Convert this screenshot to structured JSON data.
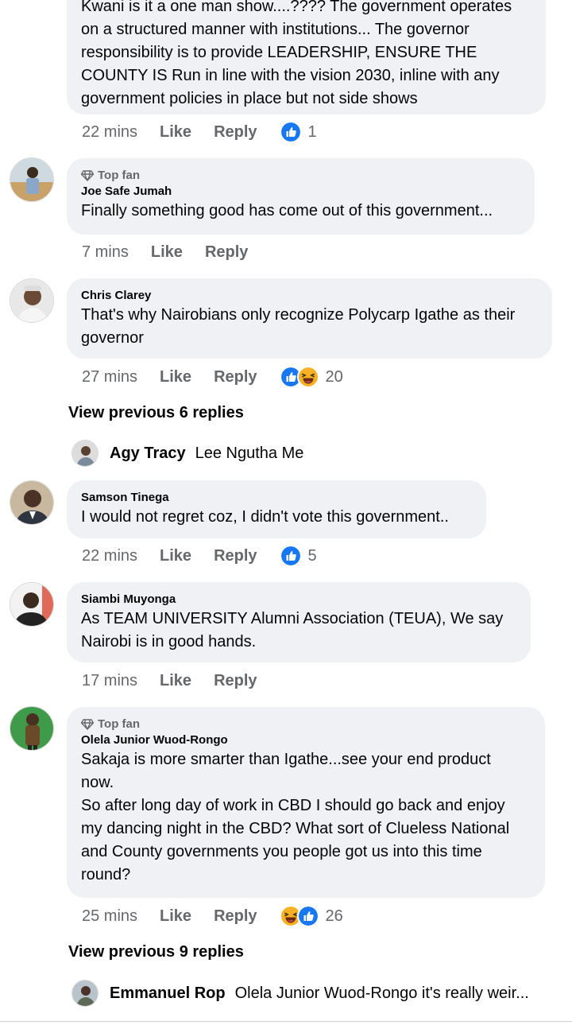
{
  "c0": {
    "lines": [
      "Kwani is it a one man show....???? The government operates",
      "on a structured manner with institutions... The governor",
      "responsibility is to provide LEADERSHIP, ENSURE THE",
      "COUNTY IS Run in line with the vision 2030, inline with any",
      "government policies in place but not side shows"
    ],
    "time": "22 mins",
    "like": "Like",
    "reply": "Reply",
    "reaction_count": "1"
  },
  "c1": {
    "top_fan": "Top fan",
    "author": "Joe Safe Jumah",
    "lines": [
      "Finally something good has come out of this government..."
    ],
    "time": "7 mins",
    "like": "Like",
    "reply": "Reply"
  },
  "c2": {
    "author": "Chris Clarey",
    "lines": [
      "That's why Nairobians only recognize Polycarp Igathe as their",
      "governor"
    ],
    "time": "27 mins",
    "like": "Like",
    "reply": "Reply",
    "reaction_count": "20",
    "view_previous": "View previous 6 replies",
    "preview_name": "Agy Tracy",
    "preview_text": "Lee Ngutha Me"
  },
  "c3": {
    "author": "Samson Tinega",
    "lines": [
      "I would not regret coz, I didn't vote this government.."
    ],
    "time": "22 mins",
    "like": "Like",
    "reply": "Reply",
    "reaction_count": "5"
  },
  "c4": {
    "author": "Siambi Muyonga",
    "lines": [
      "As TEAM UNIVERSITY Alumni Association (TEUA), We say",
      "Nairobi is in good hands."
    ],
    "time": "17 mins",
    "like": "Like",
    "reply": "Reply"
  },
  "c5": {
    "top_fan": "Top fan",
    "author": "Olela Junior Wuod-Rongo",
    "lines": [
      "Sakaja is more smarter than Igathe...see your end product",
      "now.",
      "So after long day of work in CBD I should go back and enjoy",
      "my dancing night in the CBD? What sort of Clueless National",
      "and County governments you people got us into this time",
      "round?"
    ],
    "time": "25 mins",
    "like": "Like",
    "reply": "Reply",
    "reaction_count": "26",
    "view_previous": "View previous 9 replies",
    "preview_name": "Emmanuel Rop",
    "preview_text": "Olela Junior Wuod-Rongo it's really weir..."
  },
  "colors": {
    "like_blue": "#1877f2",
    "haha_yellow": "#f7b125",
    "meta_gray": "#65676b",
    "bubble_bg": "#eff1f5"
  },
  "icons": {
    "top_fan": "diamond-icon",
    "like_reaction": "like-reaction-icon",
    "haha_reaction": "haha-reaction-icon"
  }
}
